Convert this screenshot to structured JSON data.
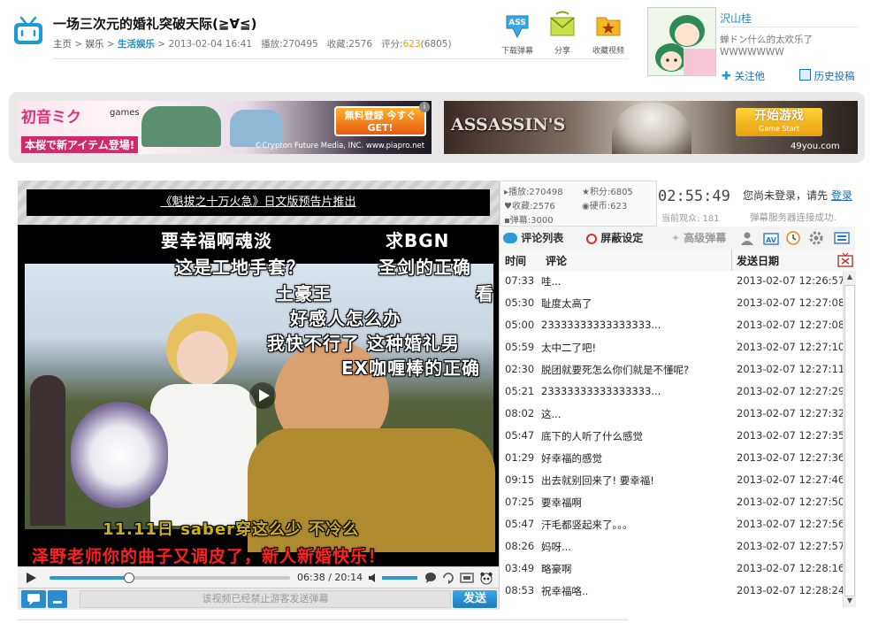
{
  "header": {
    "title": "一场三次元的婚礼突破天际(≧∀≦)",
    "breadcrumb": {
      "home": "主页",
      "section": "娱乐",
      "category": "生活娱乐",
      "date": "2013-02-04 16:41"
    },
    "stats": {
      "views_label": "播放:",
      "views": "270495",
      "favorites_label": "收藏:",
      "favorites": "2576",
      "score_label": "评分:",
      "score": "623",
      "score_extra": "(6805)"
    }
  },
  "tools": [
    {
      "label": "下载弹幕",
      "icon": "download-danmaku-icon"
    },
    {
      "label": "分享",
      "icon": "share-icon"
    },
    {
      "label": "收藏视频",
      "icon": "favorite-folder-icon"
    }
  ],
  "uploader": {
    "name": "沢山桂",
    "signature": "蝉ドン什么的太欢乐了WWWWWWW",
    "follow_label": "关注他",
    "history_label": "历史投稿"
  },
  "ads": {
    "left": {
      "brand_main": "初音ミク",
      "brand_sub": "games",
      "tagline": "本桜で新アイテム登場!",
      "button": "無料登録 今すぐGET!",
      "copyright": "©Crypton Future Media, INC. www.piapro.net"
    },
    "right": {
      "brand": "ASSASSIN'S",
      "button": "开始游戏",
      "button_sub": "Game Start",
      "site": "49you.com"
    }
  },
  "player": {
    "notice": "《魁拔之十万火急》日文版预告片推出",
    "time_current": "06:38",
    "time_total": "20:14",
    "progress": 0.33,
    "disabled_msg": "该视频已经禁止游客发送弹幕",
    "send_label": "发送",
    "danmaku": [
      "要幸福啊魂淡",
      "求BGN",
      "这是工地手套？",
      "圣剑的正确",
      "土豪王",
      "看",
      "好感人怎么办",
      "我快不行了 这种婚礼男",
      "EX咖喱棒的正确",
      "11.11日 saber穿这么少 不冷么",
      "泽野老师你的曲子又调皮了，新人新婚快乐！"
    ]
  },
  "side_stats": {
    "plays_label": "播放:",
    "plays": "270498",
    "score_label": "积分:",
    "score": "6805",
    "fav_label": "收藏:",
    "fav": "2576",
    "coins_label": "硬币:",
    "coins": "623",
    "danmaku_label": "弹幕:",
    "danmaku": "3000",
    "clock": "02:55:49",
    "viewers": "当前观众: 181",
    "login_text": "您尚未登录，请先",
    "login_link": "登录",
    "server_msg": "弹幕服务器连接成功."
  },
  "tabs": {
    "comments": "评论列表",
    "block": "屏蔽设定",
    "advanced": "高级弹幕"
  },
  "table": {
    "headers": {
      "time": "时间",
      "comment": "评论",
      "date": "发送日期"
    },
    "rows": [
      {
        "t": "07:33",
        "c": "哇...",
        "d": "2013-02-07 12:26:57"
      },
      {
        "t": "05:30",
        "c": "耻度太高了",
        "d": "2013-02-07 12:27:08"
      },
      {
        "t": "05:00",
        "c": "23333333333333333...",
        "d": "2013-02-07 12:27:08"
      },
      {
        "t": "05:59",
        "c": "太中二了吧!",
        "d": "2013-02-07 12:27:10"
      },
      {
        "t": "02:30",
        "c": "脱团就要死怎么你们就是不懂呢?",
        "d": "2013-02-07 12:27:11"
      },
      {
        "t": "05:21",
        "c": "23333333333333333...",
        "d": "2013-02-07 12:27:29"
      },
      {
        "t": "08:02",
        "c": "这...",
        "d": "2013-02-07 12:27:32"
      },
      {
        "t": "05:47",
        "c": "底下的人听了什么感觉",
        "d": "2013-02-07 12:27:35"
      },
      {
        "t": "01:29",
        "c": "好幸福的感觉",
        "d": "2013-02-07 12:27:36"
      },
      {
        "t": "09:15",
        "c": "出去就别回来了! 要幸福!",
        "d": "2013-02-07 12:27:46"
      },
      {
        "t": "07:25",
        "c": "要幸福啊",
        "d": "2013-02-07 12:27:50"
      },
      {
        "t": "05:47",
        "c": "汗毛都竖起来了。。。",
        "d": "2013-02-07 12:27:56"
      },
      {
        "t": "08:26",
        "c": "妈呀...",
        "d": "2013-02-07 12:27:57"
      },
      {
        "t": "03:49",
        "c": "略豪啊",
        "d": "2013-02-07 12:28:16"
      },
      {
        "t": "08:53",
        "c": "祝幸福咯..",
        "d": "2013-02-07 12:28:24"
      }
    ]
  }
}
